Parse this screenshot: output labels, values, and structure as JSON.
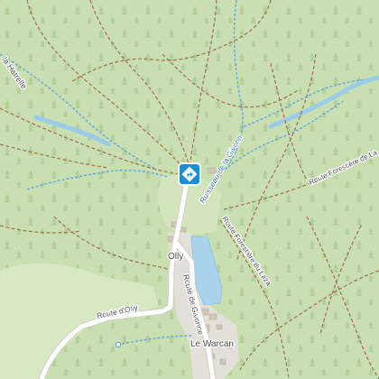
{
  "map": {
    "labels": {
      "la_hatrelle": "la Hatrelle",
      "ruisseau_givonne": "Ruisseau de la Givonne",
      "route_forestiere_la": "Route Forestière de La",
      "route_forestiere_lazaret": "Route Forestière du Lazaret",
      "olly": "Olly",
      "route_de_givonne": "Route de Givonne",
      "route_d_olly": "Route d'Olly",
      "le_warcan": "Le Warcan"
    },
    "marker": {
      "icon": "directions-diamond-icon",
      "color": "#1a8fd9"
    },
    "colors": {
      "forest": "#c9dfb2",
      "meadow": "#d9e8c4",
      "water": "#a9d3ea",
      "stream": "#5fa8e0",
      "road": "#ffffff",
      "track": "#a0704a",
      "village": "#e3e0da"
    }
  }
}
